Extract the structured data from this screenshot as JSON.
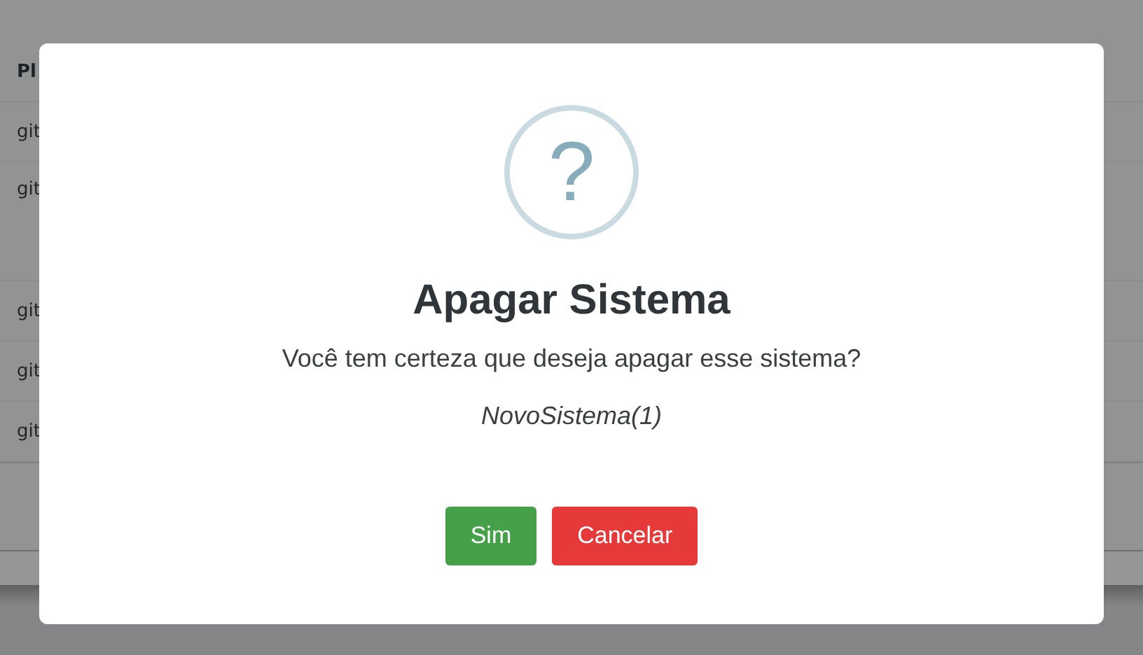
{
  "table": {
    "columns": [
      {
        "label": "Pl"
      }
    ],
    "rows": [
      {
        "column_1": "git",
        "tall": false
      },
      {
        "column_1": "git",
        "tall": true
      },
      {
        "column_1": "git",
        "tall": false
      },
      {
        "column_1": "git",
        "tall": false
      },
      {
        "column_1": "git",
        "tall": false
      }
    ]
  },
  "dialog": {
    "icon": "?",
    "title": "Apagar Sistema",
    "message": "Você tem certeza que deseja apagar esse sistema?",
    "item": "NovoSistema(1)",
    "buttons": [
      {
        "label": "Sim",
        "kind": "confirm"
      },
      {
        "label": "Cancelar",
        "kind": "cancel"
      }
    ]
  }
}
